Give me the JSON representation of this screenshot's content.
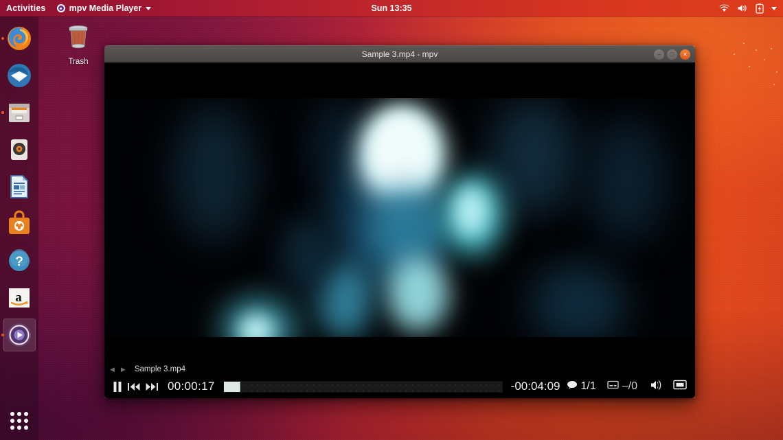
{
  "topbar": {
    "activities": "Activities",
    "app_menu": {
      "label": "mpv Media Player",
      "icon": "mpv-icon",
      "caret": "chevron-down-icon"
    },
    "clock": "Sun 13:35",
    "tray": [
      {
        "name": "wifi-icon",
        "title": "Wi-Fi"
      },
      {
        "name": "volume-icon",
        "title": "Volume"
      },
      {
        "name": "battery-charging-icon",
        "title": "Battery charging"
      },
      {
        "name": "chevron-down-icon",
        "title": "System menu"
      }
    ]
  },
  "dock": {
    "items": [
      {
        "name": "firefox",
        "label": "Firefox Web Browser",
        "running": true
      },
      {
        "name": "thunderbird",
        "label": "Thunderbird Mail",
        "running": false
      },
      {
        "name": "files",
        "label": "Files",
        "running": true
      },
      {
        "name": "rhythmbox",
        "label": "Rhythmbox",
        "running": false
      },
      {
        "name": "libreoffice-writer",
        "label": "LibreOffice Writer",
        "running": false
      },
      {
        "name": "ubuntu-software",
        "label": "Ubuntu Software",
        "running": false
      },
      {
        "name": "help",
        "label": "Help",
        "running": false
      },
      {
        "name": "amazon",
        "label": "Amazon",
        "running": false
      },
      {
        "name": "mpv",
        "label": "mpv Media Player",
        "running": true,
        "active": true
      }
    ],
    "show_applications": "Show Applications"
  },
  "desktop": {
    "icons": [
      {
        "name": "trash",
        "label": "Trash"
      }
    ]
  },
  "window": {
    "title": "Sample 3.mp4 - mpv",
    "buttons": {
      "minimize": {
        "name": "minimize-button",
        "glyph": "–"
      },
      "maximize": {
        "name": "maximize-button",
        "glyph": "□"
      },
      "close": {
        "name": "close-button",
        "glyph": "×"
      }
    }
  },
  "player": {
    "playlist": {
      "prev_glyph": "◀",
      "next_glyph": "▶",
      "filename": "Sample 3.mp4"
    },
    "controls": {
      "play_pause_state": "pause",
      "prev_chapter": "skip-back",
      "next_chapter": "skip-forward",
      "time_position": "00:00:17",
      "time_remaining": "-00:04:09",
      "progress_percent": 6,
      "audio_tracks": "1/1",
      "subtitle_tracks": "–/0",
      "volume_state": "muted",
      "fullscreen": "fullscreen"
    }
  },
  "colors": {
    "ubuntu_orange": "#e95420",
    "topbar_red": "#c62a28",
    "wallpaper_left": "#6e1038",
    "wallpaper_right": "#e9491b",
    "window_chrome": "#4a4644",
    "osc_background": "#000000",
    "seek_fill": "#dfe9e3"
  }
}
